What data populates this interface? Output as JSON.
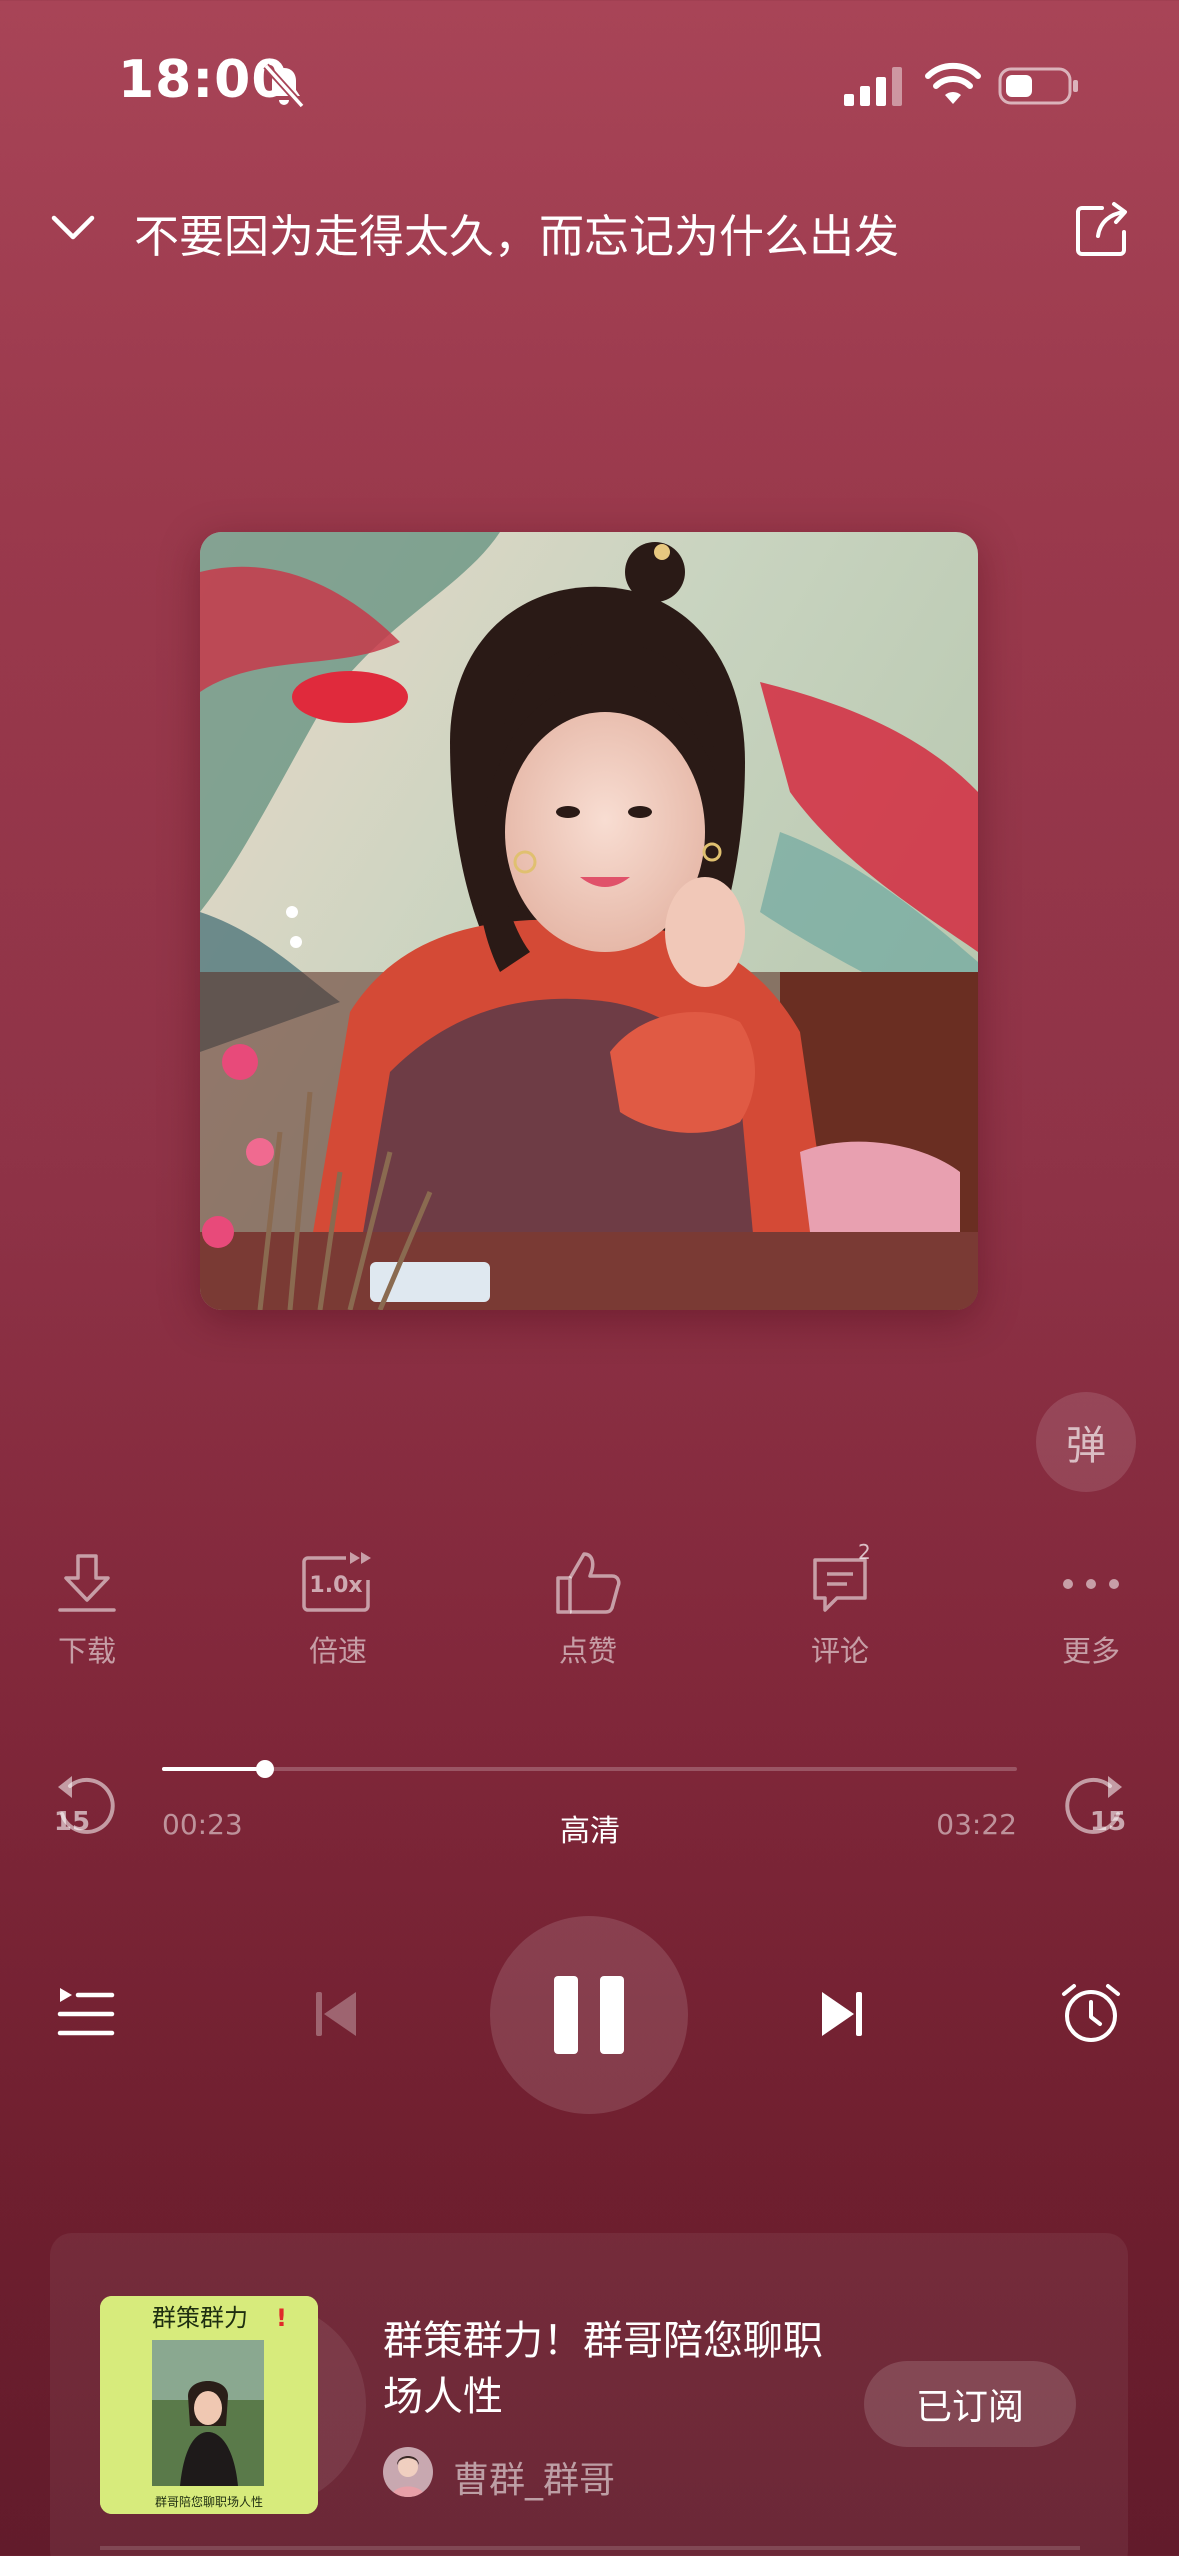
{
  "status": {
    "time": "18:00"
  },
  "header": {
    "title": "不要因为走得太久，而忘记为什么出发"
  },
  "danmaku": {
    "label": "弹"
  },
  "actions": {
    "download": "下载",
    "speed": "倍速",
    "speed_badge": "1.0x",
    "like": "点赞",
    "comment": "评论",
    "comment_count": "2",
    "more": "更多"
  },
  "progress": {
    "current": "00:23",
    "total": "03:22",
    "quality": "高清",
    "fraction": 0.12,
    "skip_back": "15",
    "skip_forward": "15"
  },
  "album": {
    "title": "群策群力！群哥陪您聊职场人性",
    "author": "曹群_群哥",
    "subscribe_label": "已订阅",
    "cover_heading": "群策群力",
    "cover_caption": "群哥陪您聊职场人性"
  },
  "colors": {
    "background_top": "#a84457",
    "background_bottom": "#621b2b",
    "accent": "#ffffff"
  }
}
